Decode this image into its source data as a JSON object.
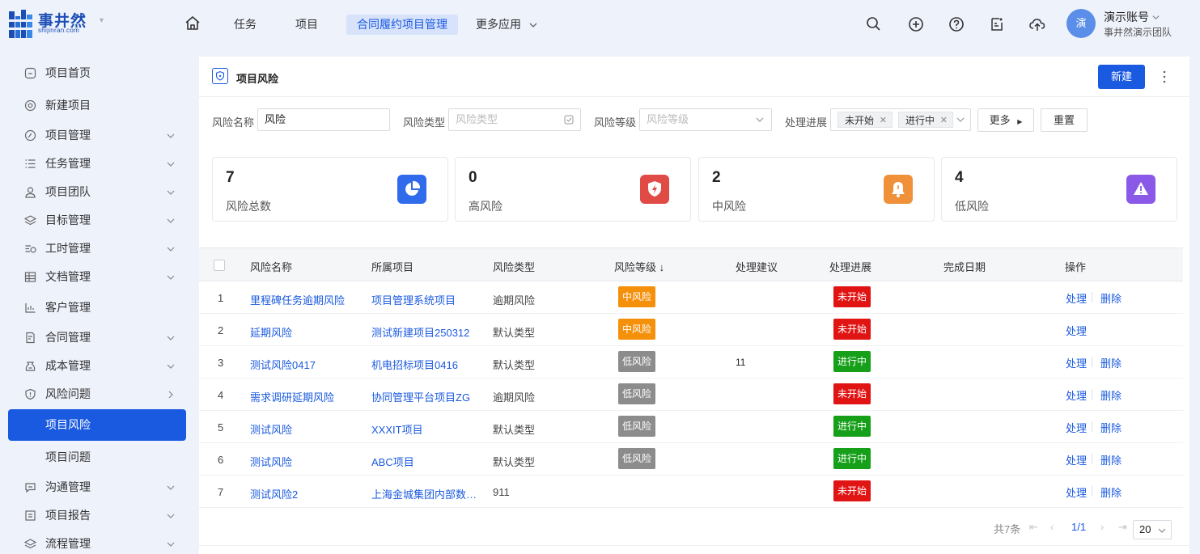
{
  "brand": {
    "name": "事井然",
    "sub": "shijinran.com"
  },
  "nav": {
    "items": [
      {
        "label": "任务"
      },
      {
        "label": "项目"
      },
      {
        "label": "合同履约项目管理"
      },
      {
        "label": "更多应用"
      }
    ]
  },
  "account": {
    "avatar": "演",
    "name": "演示账号",
    "team": "事井然演示团队"
  },
  "sidebar": {
    "items": [
      {
        "label": "项目首页",
        "icon": "home-icon"
      },
      {
        "label": "新建项目",
        "icon": "at-icon"
      },
      {
        "label": "项目管理",
        "icon": "compass-icon"
      },
      {
        "label": "任务管理",
        "icon": "list-icon"
      },
      {
        "label": "项目团队",
        "icon": "user-icon"
      },
      {
        "label": "目标管理",
        "icon": "layers-icon"
      },
      {
        "label": "工时管理",
        "icon": "clock-icon"
      },
      {
        "label": "文档管理",
        "icon": "table-icon"
      },
      {
        "label": "客户管理",
        "icon": "chart-icon"
      },
      {
        "label": "合同管理",
        "icon": "contract-icon"
      },
      {
        "label": "成本管理",
        "icon": "money-icon"
      },
      {
        "label": "风险问题",
        "icon": "shield-icon"
      },
      {
        "label": "项目风险"
      },
      {
        "label": "项目问题"
      },
      {
        "label": "沟通管理",
        "icon": "chat-icon"
      },
      {
        "label": "项目报告",
        "icon": "report-icon"
      },
      {
        "label": "流程管理",
        "icon": "flow-icon"
      }
    ]
  },
  "page": {
    "title": "项目风险",
    "new_button": "新建"
  },
  "filters": {
    "name_label": "风险名称",
    "name_value": "风险",
    "type_label": "风险类型",
    "type_placeholder": "风险类型",
    "level_label": "风险等级",
    "level_placeholder": "风险等级",
    "progress_label": "处理进展",
    "progress_tags": [
      "未开始",
      "进行中"
    ],
    "more_button": "更多",
    "reset_button": "重置"
  },
  "stats": [
    {
      "value": "7",
      "label": "风险总数",
      "color": "#2f6bea"
    },
    {
      "value": "0",
      "label": "高风险",
      "color": "#e04b46"
    },
    {
      "value": "2",
      "label": "中风险",
      "color": "#f0913a"
    },
    {
      "value": "4",
      "label": "低风险",
      "color": "#8a59e8"
    }
  ],
  "table": {
    "headers": [
      "风险名称",
      "所属项目",
      "风险类型",
      "风险等级 ↓",
      "处理建议",
      "处理进展",
      "完成日期",
      "操作"
    ],
    "rows": [
      {
        "no": "1",
        "name": "里程碑任务逾期风险",
        "project": "项目管理系统项目",
        "type": "逾期风险",
        "level": "中风险",
        "suggest": "",
        "progress": "未开始",
        "date": "",
        "ops": [
          "处理",
          "删除"
        ]
      },
      {
        "no": "2",
        "name": "延期风险",
        "project": "测试新建项目250312",
        "type": "默认类型",
        "level": "中风险",
        "suggest": "",
        "progress": "未开始",
        "date": "",
        "ops": [
          "处理"
        ]
      },
      {
        "no": "3",
        "name": "测试风险0417",
        "project": "机电招标项目0416",
        "type": "默认类型",
        "level": "低风险",
        "suggest": "11",
        "progress": "进行中",
        "date": "",
        "ops": [
          "处理",
          "删除"
        ]
      },
      {
        "no": "4",
        "name": "需求调研延期风险",
        "project": "协同管理平台项目ZG",
        "type": "逾期风险",
        "level": "低风险",
        "suggest": "",
        "progress": "未开始",
        "date": "",
        "ops": [
          "处理",
          "删除"
        ]
      },
      {
        "no": "5",
        "name": "测试风险",
        "project": "XXXIT项目",
        "type": "默认类型",
        "level": "低风险",
        "suggest": "",
        "progress": "进行中",
        "date": "",
        "ops": [
          "处理",
          "删除"
        ]
      },
      {
        "no": "6",
        "name": "测试风险",
        "project": "ABC项目",
        "type": "默认类型",
        "level": "低风险",
        "suggest": "",
        "progress": "进行中",
        "date": "",
        "ops": [
          "处理",
          "删除"
        ]
      },
      {
        "no": "7",
        "name": "测试风险2",
        "project": "上海金城集团内部数…",
        "type": "911",
        "level": "",
        "suggest": "",
        "progress": "未开始",
        "date": "",
        "ops": [
          "处理",
          "删除"
        ]
      }
    ]
  },
  "pagination": {
    "total": "共7条",
    "page": "1/1",
    "page_size": "20"
  },
  "colors": {
    "accent": "#1a5ae0",
    "mid_risk": "#f5900b",
    "low_risk": "#8c8c8c",
    "not_started": "#e11414",
    "in_progress": "#16a01a"
  }
}
